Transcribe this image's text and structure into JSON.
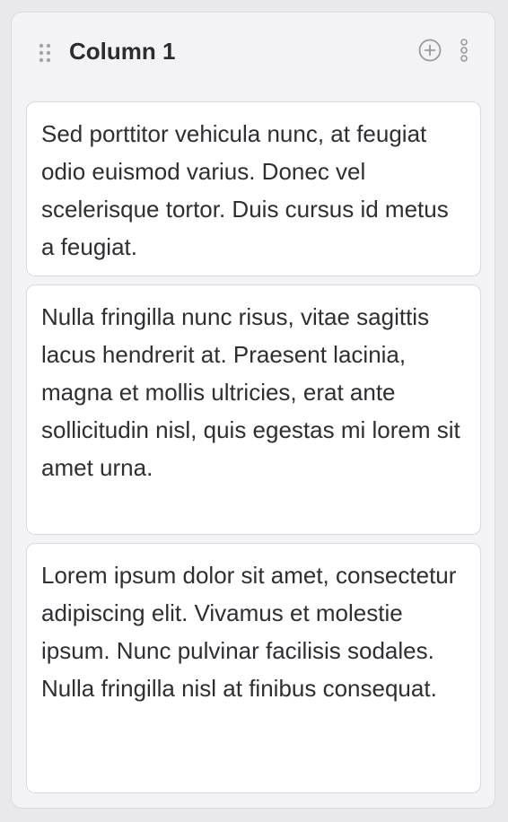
{
  "column": {
    "title": "Column 1",
    "icons": {
      "drag": "drag-handle-icon",
      "add": "plus-circle-icon",
      "more": "more-vertical-icon"
    },
    "cards": [
      {
        "text": "Sed porttitor vehicula nunc, at feugiat odio euismod varius. Donec vel scelerisque tortor. Duis cursus id metus a feugiat."
      },
      {
        "text": "Nulla fringilla nunc risus, vitae sagittis lacus hendrerit at. Praesent lacinia, magna et mollis ultricies, erat ante sollicitudin nisl, quis egestas mi lorem sit amet urna."
      },
      {
        "text": "Lorem ipsum dolor sit amet, consectetur adipiscing elit. Vivamus et molestie ipsum. Nunc pulvinar facilisis sodales. Nulla fringilla nisl at finibus consequat."
      }
    ]
  },
  "colors": {
    "page_background": "#e9e9ec",
    "column_background": "#f3f3f5",
    "card_background": "#ffffff",
    "text": "#2e2e33",
    "icon": "#9a9aa0"
  }
}
